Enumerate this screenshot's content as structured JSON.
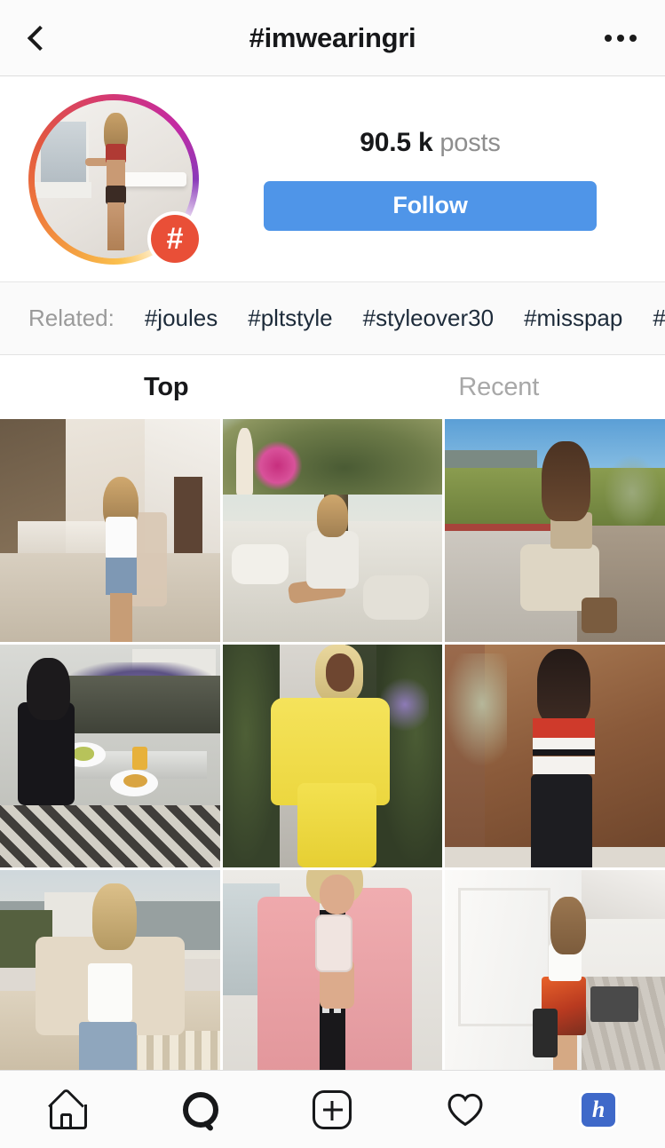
{
  "header": {
    "title": "#imwearingri",
    "back_icon": "chevron-left-icon",
    "more_icon": "ellipsis-icon"
  },
  "profile": {
    "avatar_icon": "hashtag-avatar",
    "badge_glyph": "#",
    "post_count_value": "90.5 k",
    "post_count_label": "posts",
    "follow_label": "Follow",
    "follow_color": "#4f95e8"
  },
  "related": {
    "label": "Related:",
    "tags": [
      "#joules",
      "#pltstyle",
      "#styleover30",
      "#misspap",
      "#r"
    ]
  },
  "tabs": [
    {
      "label": "Top",
      "active": true
    },
    {
      "label": "Recent",
      "active": false
    }
  ],
  "grid": {
    "cells": [
      {
        "name": "post-street-alley"
      },
      {
        "name": "post-tree-stones"
      },
      {
        "name": "post-hedge-sidewalk"
      },
      {
        "name": "post-restaurant-table"
      },
      {
        "name": "post-yellow-dress"
      },
      {
        "name": "post-striped-top"
      },
      {
        "name": "post-rooftop-kimono"
      },
      {
        "name": "post-pink-blazer-selfie"
      },
      {
        "name": "post-colonnade-walkway"
      }
    ]
  },
  "bottom_nav": {
    "items": [
      {
        "icon": "home-icon",
        "label": "Home"
      },
      {
        "icon": "search-icon",
        "label": "Search"
      },
      {
        "icon": "add-post-icon",
        "label": "Add"
      },
      {
        "icon": "heart-icon",
        "label": "Activity"
      },
      {
        "icon": "profile-avatar-icon",
        "label": "h"
      }
    ],
    "avatar_letter": "h",
    "avatar_color": "#3f69c9"
  }
}
